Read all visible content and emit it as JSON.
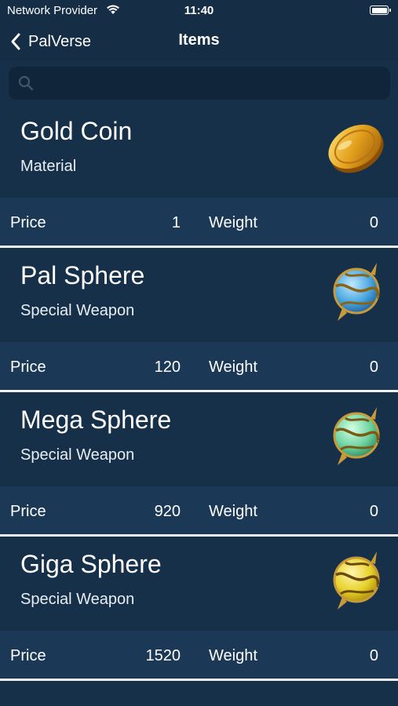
{
  "status": {
    "carrier": "Network Provider",
    "time": "11:40"
  },
  "nav": {
    "back_label": "PalVerse",
    "title": "Items"
  },
  "search": {
    "placeholder": "",
    "value": ""
  },
  "items": [
    {
      "name": "Gold Coin",
      "category": "Material",
      "price_label": "Price",
      "price": "1",
      "weight_label": "Weight",
      "weight": "0",
      "icon": "gold-coin-icon"
    },
    {
      "name": "Pal Sphere",
      "category": "Special Weapon",
      "price_label": "Price",
      "price": "120",
      "weight_label": "Weight",
      "weight": "0",
      "icon": "pal-sphere-icon"
    },
    {
      "name": "Mega Sphere",
      "category": "Special Weapon",
      "price_label": "Price",
      "price": "920",
      "weight_label": "Weight",
      "weight": "0",
      "icon": "mega-sphere-icon"
    },
    {
      "name": "Giga Sphere",
      "category": "Special Weapon",
      "price_label": "Price",
      "price": "1520",
      "weight_label": "Weight",
      "weight": "0",
      "icon": "giga-sphere-icon"
    }
  ],
  "colors": {
    "background": "#16304a",
    "stats_row": "#1b3956",
    "search_field": "#102539",
    "divider": "#f0f3f6",
    "pal_sphere": "#4aa6e0",
    "mega_sphere": "#6ed3a0",
    "giga_sphere": "#e8d22a",
    "gold": "#e2a01c"
  }
}
